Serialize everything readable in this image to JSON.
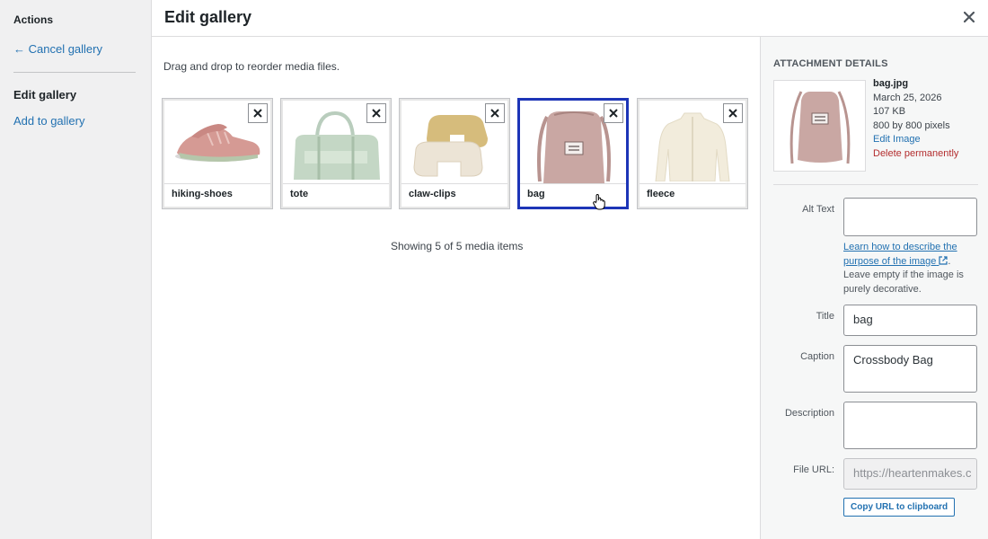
{
  "sidebar": {
    "heading": "Actions",
    "cancel_link": "← Cancel gallery",
    "active_item": "Edit gallery",
    "add_link": "Add to gallery"
  },
  "header": {
    "title": "Edit gallery",
    "close_icon": "close-icon"
  },
  "main": {
    "instructions": "Drag and drop to reorder media files.",
    "items": [
      {
        "name": "hiking-shoes",
        "selected": false
      },
      {
        "name": "tote",
        "selected": false
      },
      {
        "name": "claw-clips",
        "selected": false
      },
      {
        "name": "bag",
        "selected": true
      },
      {
        "name": "fleece",
        "selected": false
      }
    ],
    "count_text": "Showing 5 of 5 media items"
  },
  "details": {
    "heading": "ATTACHMENT DETAILS",
    "filename": "bag.jpg",
    "date": "March 25, 2026",
    "size": "107 KB",
    "dimensions": "800 by 800 pixels",
    "edit_link": "Edit Image",
    "delete_link": "Delete permanently",
    "alt_label": "Alt Text",
    "alt_value": "",
    "help_link": "Learn how to describe the purpose of the image",
    "help_suffix": ".",
    "help_text": "Leave empty if the image is purely decorative.",
    "title_label": "Title",
    "title_value": "bag",
    "caption_label": "Caption",
    "caption_value": "Crossbody Bag",
    "description_label": "Description",
    "description_value": "",
    "url_label": "File URL:",
    "url_value": "https://heartenmakes.c",
    "copy_button": "Copy URL to clipboard"
  },
  "colors": {
    "accent": "#2271b1",
    "selected_border": "#1d35b7",
    "delete": "#b32d2e"
  }
}
